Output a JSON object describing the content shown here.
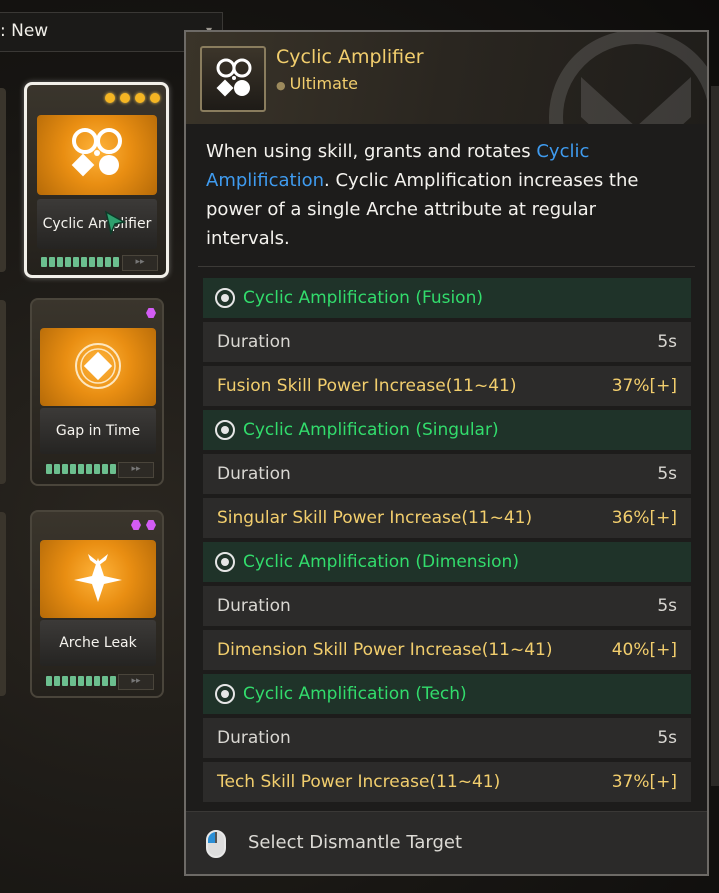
{
  "sort_bar": {
    "label": ": New"
  },
  "modules": [
    {
      "name": "Cyclic Amplifier",
      "selected": true,
      "top_icons": [
        "capacity-dot",
        "capacity-dot",
        "capacity-dot",
        "capacity-dot"
      ]
    },
    {
      "name": "Gap in Time",
      "selected": false,
      "top_icons": [
        "socket-hex"
      ]
    },
    {
      "name": "Arche Leak",
      "selected": false,
      "top_icons": [
        "socket-hex",
        "socket-hex"
      ]
    }
  ],
  "tooltip": {
    "title": "Cyclic Amplifier",
    "subtitle": "Ultimate",
    "description_before": "When using skill, grants and rotates ",
    "description_highlight": "Cyclic Amplification",
    "description_after": ". Cyclic Amplification increases the power of a single Arche attribute at regular intervals.",
    "sections": [
      {
        "header": "Cyclic Amplification (Fusion)",
        "duration_label": "Duration",
        "duration_value": "5s",
        "stat_label": "Fusion Skill Power Increase(11~41)",
        "stat_value": "37%[+]"
      },
      {
        "header": "Cyclic Amplification (Singular)",
        "duration_label": "Duration",
        "duration_value": "5s",
        "stat_label": "Singular Skill Power Increase(11~41)",
        "stat_value": "36%[+]"
      },
      {
        "header": "Cyclic Amplification (Dimension)",
        "duration_label": "Duration",
        "duration_value": "5s",
        "stat_label": "Dimension Skill Power Increase(11~41)",
        "stat_value": "40%[+]"
      },
      {
        "header": "Cyclic Amplification (Tech)",
        "duration_label": "Duration",
        "duration_value": "5s",
        "stat_label": "Tech Skill Power Increase(11~41)",
        "stat_value": "37%[+]"
      }
    ],
    "footer_label": "Select Dismantle Target",
    "footer_icon": "mouse-left-click-icon"
  },
  "colors": {
    "gold": "#f2ce6d",
    "green": "#32dc6c",
    "highlight_blue": "#3f9bef",
    "orange_art": "#e98e12"
  }
}
